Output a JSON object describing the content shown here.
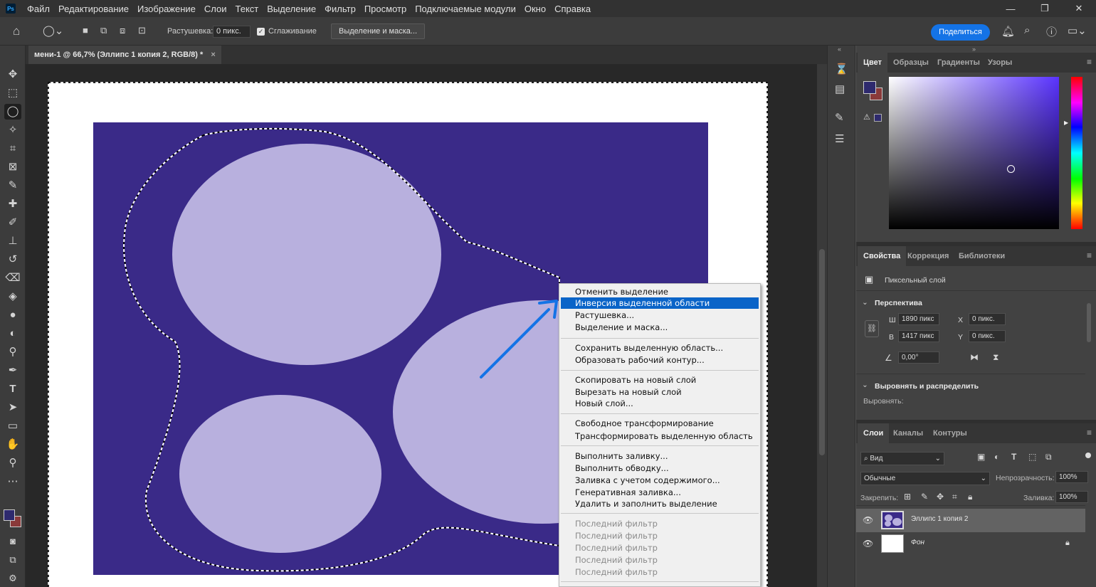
{
  "app": {
    "logo_text": "Ps"
  },
  "menu": [
    "Файл",
    "Редактирование",
    "Изображение",
    "Слои",
    "Текст",
    "Выделение",
    "Фильтр",
    "Просмотр",
    "Подключаемые модули",
    "Окно",
    "Справка"
  ],
  "window_controls": {
    "minimize": "—",
    "maximize": "❐",
    "close": "✕"
  },
  "options": {
    "feather_label": "Растушевка:",
    "feather_value": "0 пикс.",
    "antialias_label": "Сглаживание",
    "antialias_checked": true,
    "select_mask_button": "Выделение и маска...",
    "share_button": "Поделиться"
  },
  "document": {
    "tab_title": "мени-1 @ 66,7% (Эллипс 1 копия 2, RGB/8) *",
    "tab_close": "×",
    "background_color": "#3a2a88",
    "ellipse_color": "#b8b0de",
    "arrow_color": "#1473e6"
  },
  "context_menu": {
    "groups": [
      [
        "Отменить выделение",
        "Инверсия выделенной области",
        "Растушевка...",
        "Выделение и маска..."
      ],
      [
        "Сохранить выделенную область...",
        "Образовать рабочий контур..."
      ],
      [
        "Скопировать на новый слой",
        "Вырезать на новый слой",
        "Новый слой..."
      ],
      [
        "Свободное трансформирование",
        "Трансформировать выделенную область"
      ],
      [
        "Выполнить заливку...",
        "Выполнить обводку...",
        "Заливка с учетом содержимого...",
        "Генеративная заливка...",
        "Удалить и заполнить выделение"
      ],
      [
        "Последний фильтр",
        "Последний фильтр",
        "Последний фильтр",
        "Последний фильтр",
        "Последний фильтр"
      ]
    ],
    "selected_item": "Инверсия выделенной области"
  },
  "color_panel": {
    "tabs": [
      "Цвет",
      "Образцы",
      "Градиенты",
      "Узоры"
    ],
    "active_tab": "Цвет",
    "foreground": "#2e2a6e",
    "background": "#8a3a3a"
  },
  "properties_panel": {
    "tabs": [
      "Свойства",
      "Коррекция",
      "Библиотеки"
    ],
    "active_tab": "Свойства",
    "layer_type": "Пиксельный слой",
    "perspective_section": "Перспектива",
    "w_label": "Ш",
    "w_value": "1890 пикс",
    "h_label": "В",
    "h_value": "1417 пикс",
    "x_label": "X",
    "x_value": "0 пикс.",
    "y_label": "Y",
    "y_value": "0 пикс.",
    "angle_value": "0,00°",
    "align_section": "Выровнять и распределить",
    "align_label": "Выровнять:"
  },
  "layers_panel": {
    "tabs": [
      "Слои",
      "Каналы",
      "Контуры"
    ],
    "active_tab": "Слои",
    "filter_placeholder": "Вид",
    "blend_mode": "Обычные",
    "opacity_label": "Непрозрачность:",
    "opacity_value": "100%",
    "lock_label": "Закрепить:",
    "fill_label": "Заливка:",
    "fill_value": "100%",
    "layers": [
      {
        "name": "Эллипс 1 копия 2",
        "selected": true
      },
      {
        "name": "Фон",
        "selected": false
      }
    ]
  }
}
